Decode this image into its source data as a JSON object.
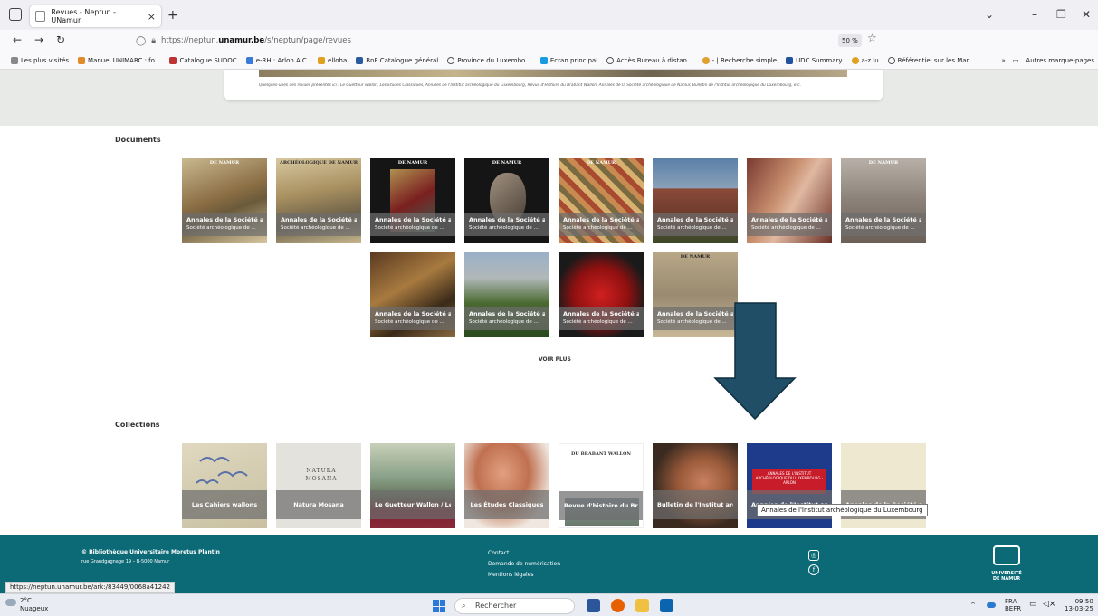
{
  "browser": {
    "tab_title": "Revues - Neptun - UNamur",
    "tab_close": "×",
    "new_tab": "+",
    "url_prefix": "https://neptun.",
    "url_domain": "unamur.be",
    "url_suffix": "/s/neptun/page/revues",
    "zoom": "50 %",
    "bookmarks": [
      "Les plus visités",
      "Manuel UNIMARC : fo...",
      "Catalogue SUDOC",
      "e-RH : Arlon A.C.",
      "elloha",
      "BnF Catalogue général",
      "Province du Luxembo...",
      "Ecran principal",
      "Accès Bureau à distan...",
      "- | Recherche simple",
      "UDC Summary",
      "a-z.lu",
      "Référentiel sur les Mar..."
    ],
    "bookmarks_overflow": "»",
    "other_bookmarks": "Autres marque-pages"
  },
  "page": {
    "caption": "Quelques-unes des revues présentes ici : Le Guetteur wallon, Les Études Classiques, Annales de l'Institut archéologique du Luxembourg, Revue d'Histoire du Brabant Wallon, Annales de la Société archéologique de Namur, Bulletin de l'Institut archéologique du Luxembourg, etc.",
    "documents_title": "Documents",
    "documents": [
      {
        "title": "Annales de la Société ar...",
        "subtitle": "Société archéologique de ...",
        "header": "DE NAMUR"
      },
      {
        "title": "Annales de la Société ar...",
        "subtitle": "Société archéologique de ...",
        "header": "ARCHÉOLOGIQUE DE NAMUR"
      },
      {
        "title": "Annales de la Société ar...",
        "subtitle": "Société archéologique de ...",
        "header": "DE NAMUR"
      },
      {
        "title": "Annales de la Société ar...",
        "subtitle": "Société archéologique de ...",
        "header": "DE NAMUR"
      },
      {
        "title": "Annales de la Société ar...",
        "subtitle": "Société archéologique de ...",
        "header": "DE NAMUR"
      },
      {
        "title": "Annales de la Société ar...",
        "subtitle": "Société archéologique de ...",
        "header": ""
      },
      {
        "title": "Annales de la Société ar...",
        "subtitle": "Société archéologique de ...",
        "header": ""
      },
      {
        "title": "Annales de la Société ar...",
        "subtitle": "Société archéologique de ...",
        "header": "DE NAMUR"
      },
      {
        "title": "Annales de la Société ar...",
        "subtitle": "Société archéologique de ...",
        "header": ""
      },
      {
        "title": "Annales de la Société ar...",
        "subtitle": "Société archéologique de ...",
        "header": ""
      },
      {
        "title": "Annales de la Société ar...",
        "subtitle": "Société archéologique de ...",
        "header": ""
      },
      {
        "title": "Annales de la Société ar...",
        "subtitle": "Société archéologique de ...",
        "header": "DE NAMUR"
      }
    ],
    "voir_plus": "VOIR PLUS",
    "collections_title": "Collections",
    "collections": [
      {
        "title": "Les Cahiers wallons"
      },
      {
        "title": "Natura Mosana",
        "cover_text": "NATURA MOSANA"
      },
      {
        "title": "Le Guetteur Wallon / Le..."
      },
      {
        "title": "Les Études Classiques"
      },
      {
        "title": "Revue d'histoire du Bra...",
        "cover_text": "DU BRABANT WALLON"
      },
      {
        "title": "Bulletin de l'Institut arc..."
      },
      {
        "title": "Annales de l'Institut arc...",
        "cover_text": "ANNALES DE L'INSTITUT ARCHÉOLOGIQUE DU LUXEMBOURG - ARLON"
      },
      {
        "title": "Annales de la Société ar..."
      }
    ],
    "tooltip": "Annales de l'Institut archéologique du Luxembourg"
  },
  "footer": {
    "title": "© Bibliothèque Universitaire Moretus Plantin",
    "address": "rue Grandgagnage 19 – B-5000 Namur",
    "links": [
      "Contact",
      "Demande de numérisation",
      "Mentions légales"
    ],
    "logo_text": "UNIVERSITÉ DE NAMUR"
  },
  "status_url": "https://neptun.unamur.be/ark:/83449/0068a41242",
  "taskbar": {
    "temp": "2°C",
    "weather": "Nuageux",
    "search": "Rechercher",
    "lang1": "FRA",
    "lang2": "BEFR",
    "time": "09:50",
    "date": "13-03-25"
  },
  "colors": {
    "footer": "#0b6a76",
    "arrow": "#1f4e66",
    "band": "#e8eae8"
  }
}
